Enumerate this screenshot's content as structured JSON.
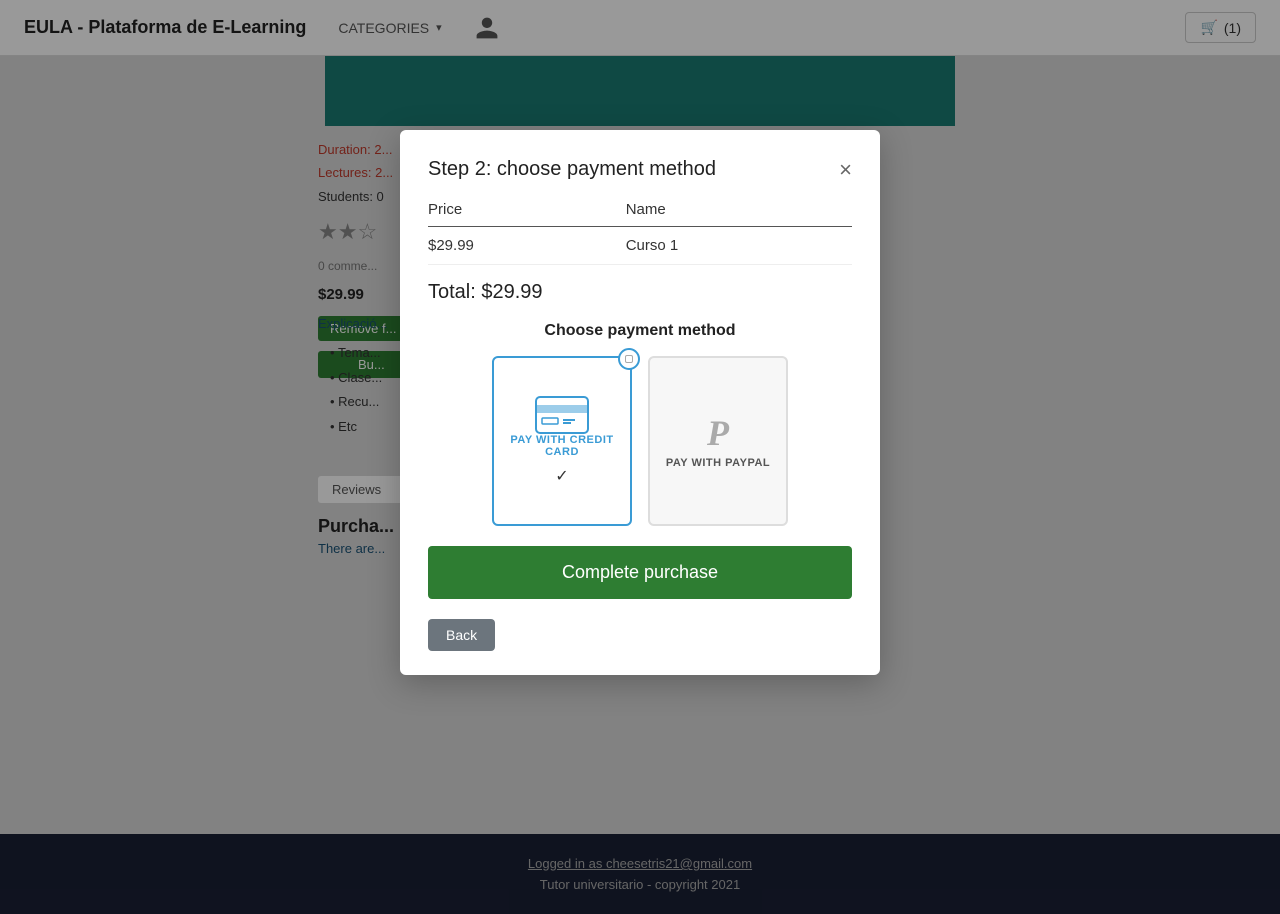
{
  "navbar": {
    "brand": "EULA - Plataforma de E-Learning",
    "categories_label": "CATEGORIES",
    "cart_label": "(1)"
  },
  "background": {
    "duration_label": "Duration:",
    "lectures_label": "Lectures:",
    "students_label": "Students: 0",
    "price": "$29.99",
    "remove_button": "Remove f...",
    "buy_button": "Bu...",
    "explicacion": "Explicació...",
    "bullets": [
      "Tema...",
      "Clase...",
      "Recu...",
      "Etc"
    ],
    "reviews_label": "Reviews",
    "purchase_title": "Purcha...",
    "purchase_sub": "There are..."
  },
  "footer": {
    "login_text": "Logged in as cheesetris21@gmail.com",
    "copyright": "Tutor universitario - copyright 2021"
  },
  "modal": {
    "title": "Step 2: choose payment method",
    "close_label": "×",
    "table": {
      "col_price": "Price",
      "col_name": "Name",
      "row_price": "$29.99",
      "row_name": "Curso 1"
    },
    "total_label": "Total: $29.99",
    "choose_label": "Choose payment method",
    "payment_options": [
      {
        "id": "credit_card",
        "label": "PAY WITH CREDIT CARD",
        "selected": true,
        "show_check": true
      },
      {
        "id": "paypal",
        "label": "PAY WITH PAYPAL",
        "selected": false,
        "show_check": false
      }
    ],
    "complete_button": "Complete purchase",
    "back_button": "Back"
  }
}
